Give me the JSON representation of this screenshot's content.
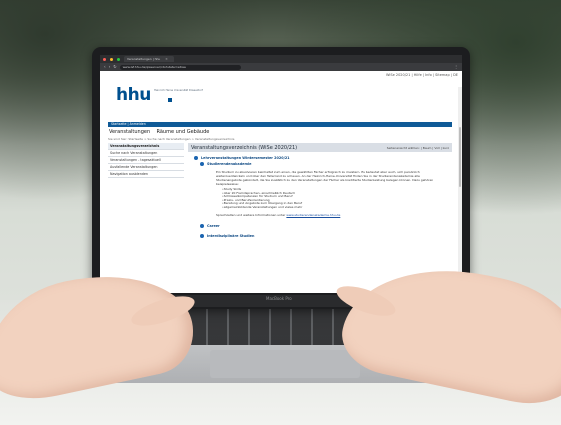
{
  "browser": {
    "tab_title": "Veranstaltungen | hhu",
    "url": "www.lsf.hhu.de/qisserver/rds?state=wtree",
    "nav_icons": [
      "back-icon",
      "forward-icon",
      "reload-icon",
      "home-icon"
    ]
  },
  "site": {
    "top_meta": "WiSe 2020/21 | Hilfe | Info | Sitemap | DE",
    "logo": "hhu",
    "logo_subtitle": "Heinrich Heine Universität Düsseldorf",
    "bluebar": "Startseite | Anmelden",
    "section_title": "Veranstaltungen",
    "section_subtitle": "Räume und Gebäude",
    "breadcrumb": "Sie sind hier: Startseite > Suche nach Veranstaltungen > Veranstaltungsverzeichnis",
    "sidebar": [
      "Veranstaltungsverzeichnis",
      "Suche nach Veranstaltungen",
      "Veranstaltungen - tagesaktuell",
      "Ausfallende Veranstaltungen",
      "Navigation ausblenden"
    ],
    "content_title": "Veranstaltungsverzeichnis (WiSe 2020/21)",
    "content_tools": "Seitenansicht wählen: | Baum | Voll | kurz",
    "tree": {
      "root": "Lehrveranstaltungen Wintersemester 2020/21",
      "node1": "Studierendenakademie",
      "description": "Ein Studium zu absolvieren beinhaltet zum einen, die gewählten Fächer erfolgreich zu meistern. Es bedeutet aber auch, sich persönlich weiterzuentwickeln und über den Tellerrand zu schauen. An der Heinrich-Heine-Universität finden Sie in der Studierendenakademie alle Studienangebote gebündelt, die Sie zusätzlich zu den Veranstaltungen der Fächer als kreditierte Studienleistung belegen können. Dazu gehören beispielsweise:",
      "list": [
        "Study Skills",
        "über 20 Fremdsprachen, einschließlich Deutsch",
        "Schlüsselkompetenzen für Studium und Beruf",
        "Praxis- und Berufsorientierung",
        "Beratung und Angebote zum Übergang in den Beruf",
        "allgemeinbildende Veranstaltungen und vieles mehr"
      ],
      "more_prefix": "Sprechzeiten und weitere Informationen unter",
      "more_link": "www.studierendenakademie.hhu.de",
      "node2": "Career",
      "node3": "Interdisziplinäre Studien"
    }
  },
  "laptop_brand": "MacBook Pro",
  "colors": {
    "hhu_blue": "#00508f",
    "bar_blue": "#0f5a97"
  }
}
